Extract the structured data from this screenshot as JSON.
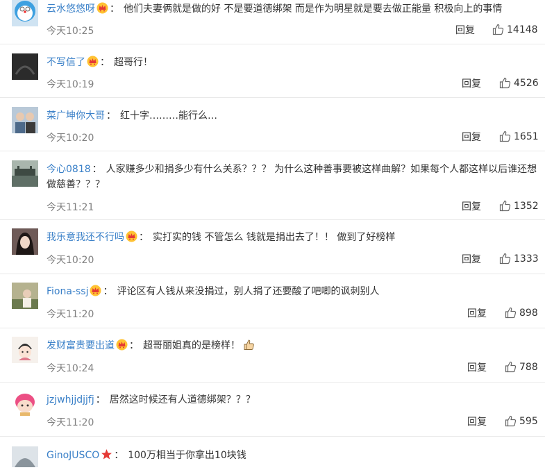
{
  "comments": [
    {
      "user": "云水悠悠呀",
      "colon": "：",
      "text": "他们夫妻俩就是做的好 不是要道德绑架 而是作为明星就是要去做正能量 积极向上的事情",
      "time": "今天10:25",
      "reply": "回复",
      "likes": "14148",
      "crown": true
    },
    {
      "user": "不写信了",
      "colon": "：",
      "text": "超哥行！",
      "time": "今天10:19",
      "reply": "回复",
      "likes": "4526",
      "crown": true
    },
    {
      "user": "菜广坤你大哥",
      "colon": "：",
      "text": "红十字………能行么…",
      "time": "今天10:20",
      "reply": "回复",
      "likes": "1651",
      "crown": false
    },
    {
      "user": "今心0818",
      "colon": "：",
      "text": "人家赚多少和捐多少有什么关系？？？ 为什么这种善事要被这样曲解？如果每个人都这样以后谁还想做慈善？？？",
      "time": "今天11:21",
      "reply": "回复",
      "likes": "1352",
      "crown": false
    },
    {
      "user": "我乐意我还不行吗",
      "colon": "：",
      "text": "实打实的钱 不管怎么 钱就是捐出去了！！ 做到了好榜样",
      "time": "今天10:20",
      "reply": "回复",
      "likes": "1333",
      "crown": true
    },
    {
      "user": "Fiona-ssj",
      "colon": "：",
      "text": "评论区有人钱从来没捐过，别人捐了还要酸了吧唧的讽刺别人",
      "time": "今天11:20",
      "reply": "回复",
      "likes": "898",
      "crown": true
    },
    {
      "user": "发财富贵要出道",
      "colon": "：",
      "text": "超哥丽姐真的是榜样！",
      "time": "今天10:24",
      "reply": "回复",
      "likes": "788",
      "crown": true,
      "emoji": "thumbs-up-emoji"
    },
    {
      "user": "jzjwhjjdjjfj",
      "colon": "：",
      "text": "居然这时候还有人道德绑架？？？",
      "time": "今天11:20",
      "reply": "回复",
      "likes": "595",
      "crown": false
    },
    {
      "user": "GinoJUSCO",
      "colon": "：",
      "text": "100万相当于你拿出10块钱",
      "crown": false,
      "badge": "star-badge-icon"
    }
  ]
}
